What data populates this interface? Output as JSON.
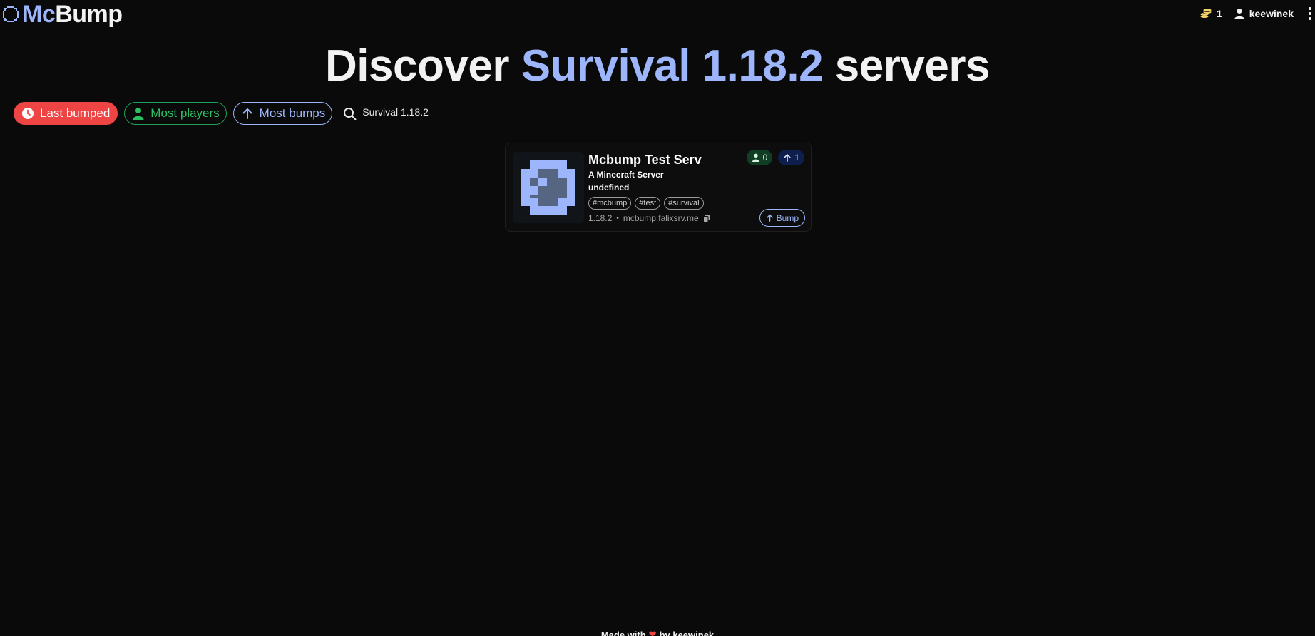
{
  "header": {
    "logo_mc": "Mc",
    "logo_bump": "Bump",
    "coins": "1",
    "username": "keewinek"
  },
  "title": {
    "prefix": "Discover",
    "highlight": "Survival 1.18.2",
    "suffix": "servers"
  },
  "filters": {
    "last_bumped": "Last bumped",
    "most_players": "Most players",
    "most_bumps": "Most bumps",
    "search_value": "Survival 1.18.2"
  },
  "servers": [
    {
      "name": "Mcbump Test Serv",
      "description": "A Minecraft Server",
      "extra": "undefined",
      "tags": [
        "#mcbump",
        "#test",
        "#survival"
      ],
      "version": "1.18.2",
      "address": "mcbump.falixsrv.me",
      "players": "0",
      "bumps": "1",
      "bump_label": "Bump"
    }
  ],
  "footer": {
    "made_with": "Made with",
    "by": "by keewinek"
  },
  "colors": {
    "accent": "#9db5fb",
    "red": "#ef4444",
    "green": "#2bbf64",
    "background": "#0a0a0a"
  },
  "icons": [
    "logo-icon",
    "coin-icon",
    "user-icon",
    "more-icon",
    "clock-icon",
    "person-icon",
    "arrow-up-icon",
    "search-icon",
    "copy-icon",
    "heart-icon"
  ]
}
